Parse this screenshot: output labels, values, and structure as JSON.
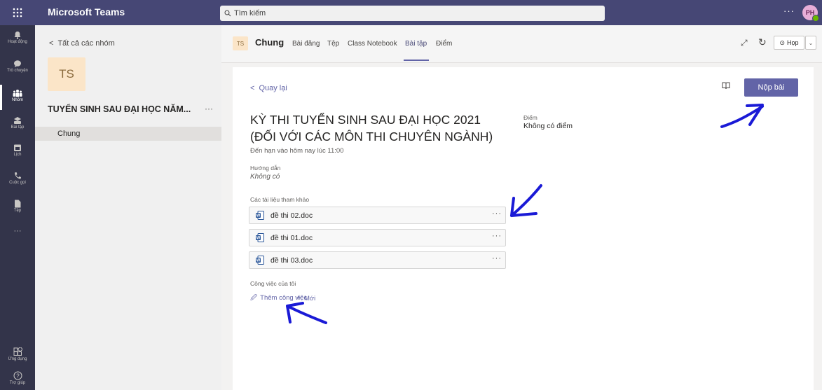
{
  "topbar": {
    "app_name": "Microsoft Teams",
    "search_placeholder": "Tìm kiếm",
    "more": "···",
    "avatar_initials": "PH"
  },
  "rail": {
    "items": [
      {
        "label": "Hoạt động",
        "icon": "bell-icon"
      },
      {
        "label": "Trò chuyện",
        "icon": "chat-icon"
      },
      {
        "label": "Nhóm",
        "icon": "teams-icon"
      },
      {
        "label": "Bài tập",
        "icon": "assignments-icon"
      },
      {
        "label": "Lịch",
        "icon": "calendar-icon"
      },
      {
        "label": "Cuộc gọi",
        "icon": "phone-icon"
      },
      {
        "label": "Tệp",
        "icon": "file-icon"
      },
      {
        "label": "···",
        "icon": "more-icon"
      },
      {
        "label": "Ứng dụng",
        "icon": "apps-icon"
      },
      {
        "label": "Trợ giúp",
        "icon": "help-icon"
      }
    ]
  },
  "left_panel": {
    "back_label": "Tất cả các nhóm",
    "team_initials": "TS",
    "team_name": "TUYỂN SINH SAU ĐẠI HỌC NĂM...",
    "more": "···",
    "channel": "Chung"
  },
  "header": {
    "channel_initials": "TS",
    "channel_name": "Chung",
    "tabs": [
      "Bài đăng",
      "Tệp",
      "Class Notebook",
      "Bài tập",
      "Điểm"
    ],
    "active_tab": "Bài tập",
    "meet_label": "Họp"
  },
  "assignment": {
    "back": "Quay lại",
    "submit": "Nộp bài",
    "title": "KỲ THI TUYỂN SINH SAU ĐẠI HỌC 2021 (ĐỐI VỚI CÁC MÔN THI CHUYÊN NGÀNH)",
    "due": "Đến hạn vào hôm nay lúc 11:00",
    "points_label": "Điểm",
    "points_value": "Không có điểm",
    "instructions_label": "Hướng dẫn",
    "instructions_value": "Không có",
    "references_label": "Các tài liệu tham khảo",
    "files": [
      {
        "name": "đề thi 02.doc"
      },
      {
        "name": "đề thi 01.doc"
      },
      {
        "name": "đề thi 03.doc"
      }
    ],
    "my_work_label": "Công việc của tôi",
    "add_work": "Thêm công việc",
    "add_new": "Mới"
  },
  "colors": {
    "topbar": "#464775",
    "rail": "#33344a",
    "accent": "#6264a7",
    "annotation": "#1a1ad6"
  }
}
